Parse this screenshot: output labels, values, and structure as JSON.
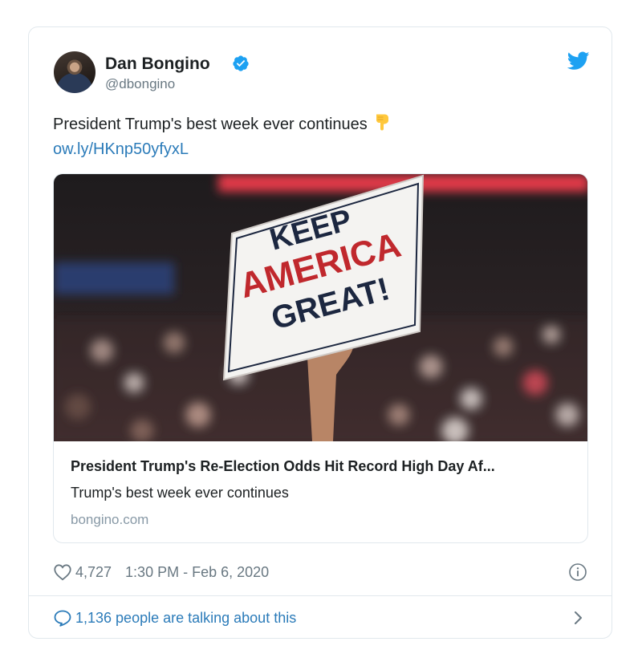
{
  "author": {
    "name": "Dan Bongino",
    "handle": "@dbongino",
    "verified": true
  },
  "tweet": {
    "text": "President Trump's best week ever continues",
    "emoji": "pointing-down-emoji",
    "link": "ow.ly/HKnp50yfyxL"
  },
  "card": {
    "sign_lines": [
      "KEEP",
      "AMERICA",
      "GREAT!"
    ],
    "title": "President Trump's Re-Election Odds Hit Record High Day Af...",
    "description": "Trump's best week ever continues",
    "domain": "bongino.com"
  },
  "meta": {
    "likes": "4,727",
    "timestamp": "1:30 PM - Feb 6, 2020"
  },
  "footer": {
    "talking": "1,136 people are talking about this"
  },
  "icons": {
    "verified": "verified-badge-icon",
    "twitter": "twitter-bird-icon",
    "like": "heart-icon",
    "info": "info-icon",
    "reply": "speech-bubble-icon",
    "chevron": "chevron-right-icon"
  },
  "colors": {
    "accent": "#1da1f2",
    "link": "#2b7bb9",
    "muted": "#697882",
    "border": "#e1e8ed",
    "sign_red": "#c0282d"
  }
}
